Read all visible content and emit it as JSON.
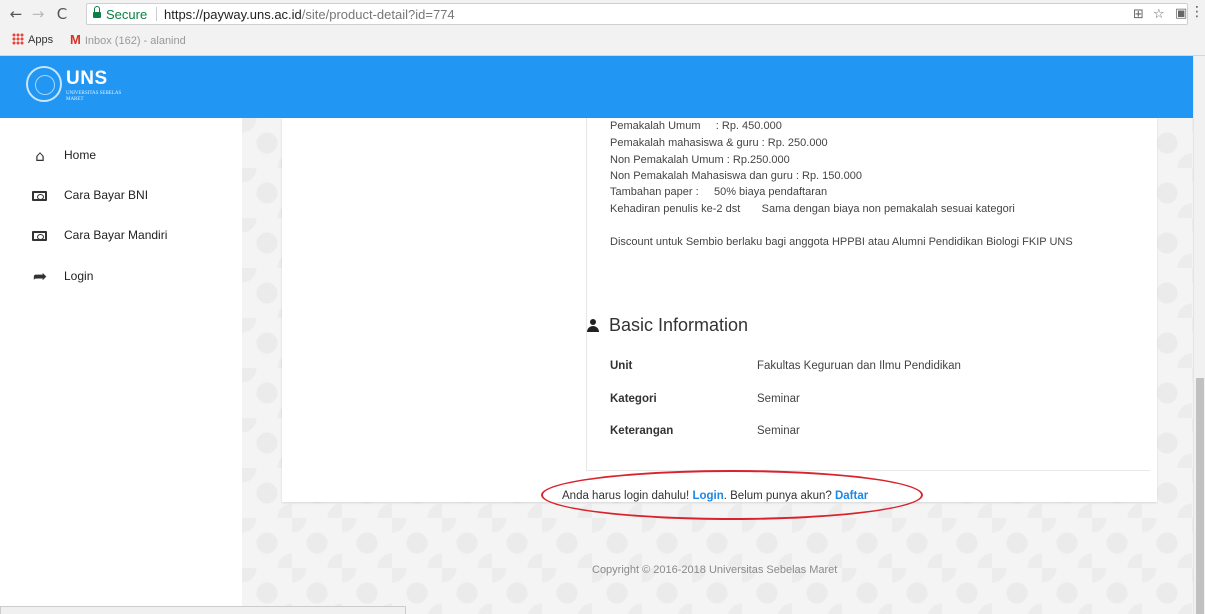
{
  "browser": {
    "secure_label": "Secure",
    "url_host": "https://payway.uns.ac.id",
    "url_path": "/site/product-detail?id=774",
    "bookmarks": [
      {
        "label": "Apps",
        "icon": "apps-grid-icon"
      },
      {
        "label": "Inbox (162) - alanind",
        "icon": "gmail-icon"
      }
    ]
  },
  "header": {
    "logo_text": "UNS",
    "logo_sub": "UNIVERSITAS SEBELAS MARET",
    "brand_color": "#2196f3"
  },
  "sidebar": {
    "items": [
      {
        "label": "Home",
        "icon": "home-icon"
      },
      {
        "label": "Cara Bayar BNI",
        "icon": "money-icon"
      },
      {
        "label": "Cara Bayar Mandiri",
        "icon": "money-icon"
      },
      {
        "label": "Login",
        "icon": "share-arrow-icon"
      }
    ]
  },
  "pricing": {
    "lines": [
      "Pemakalah Umum     : Rp. 450.000",
      "Pemakalah mahasiswa & guru : Rp. 250.000",
      "Non Pemakalah Umum : Rp.250.000",
      "Non Pemakalah Mahasiswa dan guru : Rp. 150.000",
      "Tambahan paper :     50% biaya pendaftaran",
      "Kehadiran penulis ke-2 dst       Sama dengan biaya non pemakalah sesuai kategori"
    ],
    "discount": "Discount untuk Sembio berlaku bagi anggota HPPBI atau Alumni Pendidikan Biologi FKIP UNS"
  },
  "basic_info": {
    "title": "Basic Information",
    "rows": [
      {
        "label": "Unit",
        "value": "Fakultas Keguruan dan Ilmu Pendidikan"
      },
      {
        "label": "Kategori",
        "value": "Seminar"
      },
      {
        "label": "Keterangan",
        "value": "Seminar"
      }
    ]
  },
  "login_note": {
    "prefix": "Anda harus login dahulu! ",
    "login_link": "Login",
    "middle": ". Belum punya akun? ",
    "register_link": "Daftar"
  },
  "footer": {
    "copyright": "Copyright © 2016-2018 Universitas Sebelas Maret"
  }
}
